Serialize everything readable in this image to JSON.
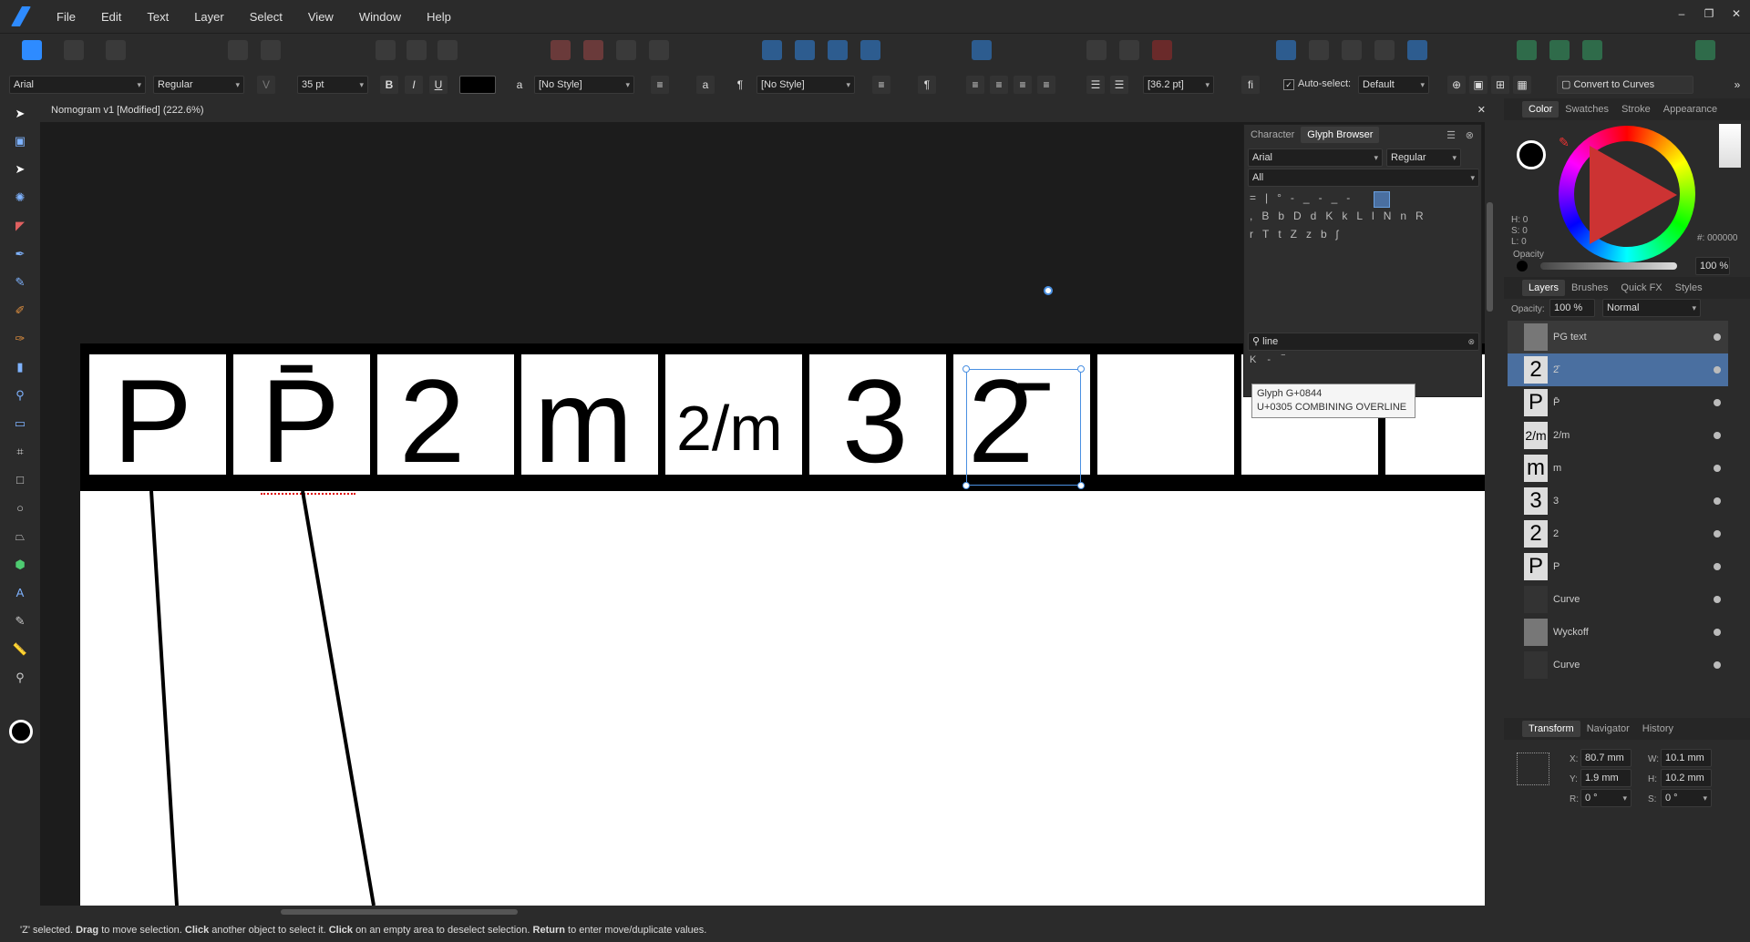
{
  "menubar": {
    "items": [
      "File",
      "Edit",
      "Text",
      "Layer",
      "Select",
      "View",
      "Window",
      "Help"
    ],
    "window_controls": [
      "–",
      "❐",
      "✕"
    ]
  },
  "context_toolbar": {
    "font_family": "Arial",
    "font_style": "Regular",
    "font_size": "35 pt",
    "bold": "B",
    "italic": "I",
    "underline": "U",
    "char_style": "[No Style]",
    "para_style": "[No Style]",
    "leading": "[36.2 pt]",
    "fi": "fi",
    "autoselect_label": "Auto-select:",
    "autoselect_value": "Default",
    "convert_label": "Convert to Curves",
    "a_glyph": "a",
    "pilcrow": "¶"
  },
  "document": {
    "title": "Nomogram v1 [Modified] (222.6%)"
  },
  "canvas": {
    "cells": [
      "P",
      "P̄",
      "2",
      "m",
      "2/m",
      "3",
      "2̄"
    ]
  },
  "glyph_browser": {
    "tabs": [
      "Character",
      "Glyph Browser"
    ],
    "font": "Arial",
    "style": "Regular",
    "subset": "All",
    "grid_row1": [
      "=",
      "|",
      "°",
      "-",
      "_",
      "",
      "",
      "",
      "-",
      "_",
      "-"
    ],
    "grid_row2": [
      ",",
      "B",
      "b",
      "D",
      "d",
      "K",
      "k",
      "L",
      "l",
      "N",
      "n",
      "R"
    ],
    "grid_row3": [
      "r",
      "T",
      "t",
      "Z",
      "z",
      "b",
      "ʃ"
    ],
    "search_value": "line",
    "results": [
      "K",
      "-",
      "‾"
    ],
    "tooltip_line1": "Glyph G+0844",
    "tooltip_line2": "U+0305 COMBINING OVERLINE"
  },
  "color_panel": {
    "tabs": [
      "Color",
      "Swatches",
      "Stroke",
      "Appearance"
    ],
    "hsl": [
      "H: 0",
      "S: 0",
      "L: 0"
    ],
    "hex_label": "#:",
    "hex_value": "000000",
    "opacity_label": "Opacity",
    "opacity_value": "100 %"
  },
  "layers_panel": {
    "tabs": [
      "Layers",
      "Brushes",
      "Quick FX",
      "Styles"
    ],
    "opacity_label": "Opacity:",
    "opacity_value": "100 %",
    "blend_mode": "Normal",
    "items": [
      {
        "type": "group",
        "name": "PG text",
        "thumb": ""
      },
      {
        "type": "A",
        "name": "2̄",
        "thumb": "2"
      },
      {
        "type": "A",
        "name": "P̄",
        "thumb": "P"
      },
      {
        "type": "A",
        "name": "2/m",
        "thumb": "2/m"
      },
      {
        "type": "A",
        "name": "m",
        "thumb": "m"
      },
      {
        "type": "A",
        "name": "3",
        "thumb": "3"
      },
      {
        "type": "A",
        "name": "2",
        "thumb": "2"
      },
      {
        "type": "A",
        "name": "P",
        "thumb": "P"
      },
      {
        "type": "curve",
        "name": "Curve",
        "thumb": ""
      },
      {
        "type": "group",
        "name": "Wyckoff",
        "thumb": ""
      },
      {
        "type": "curve",
        "name": "Curve",
        "thumb": ""
      }
    ]
  },
  "transform_panel": {
    "tabs": [
      "Transform",
      "Navigator",
      "History"
    ],
    "x_label": "X:",
    "x": "80.7 mm",
    "y_label": "Y:",
    "y": "1.9 mm",
    "w_label": "W:",
    "w": "10.1 mm",
    "h_label": "H:",
    "h": "10.2 mm",
    "r_label": "R:",
    "r": "0 °",
    "s_label": "S:",
    "s": "0 °"
  },
  "status": {
    "text_sel": "'Z' selected.",
    "drag": "Drag",
    "t1": "to move selection.",
    "click1": "Click",
    "t2": "another object to select it.",
    "click2": "Click",
    "t3": "on an empty area to deselect selection.",
    "ret": "Return",
    "t4": "to enter move/duplicate values."
  },
  "colors": {
    "accent": "#4a90e2",
    "selection": "#5b8fd6",
    "bg": "#2b2b2b"
  }
}
